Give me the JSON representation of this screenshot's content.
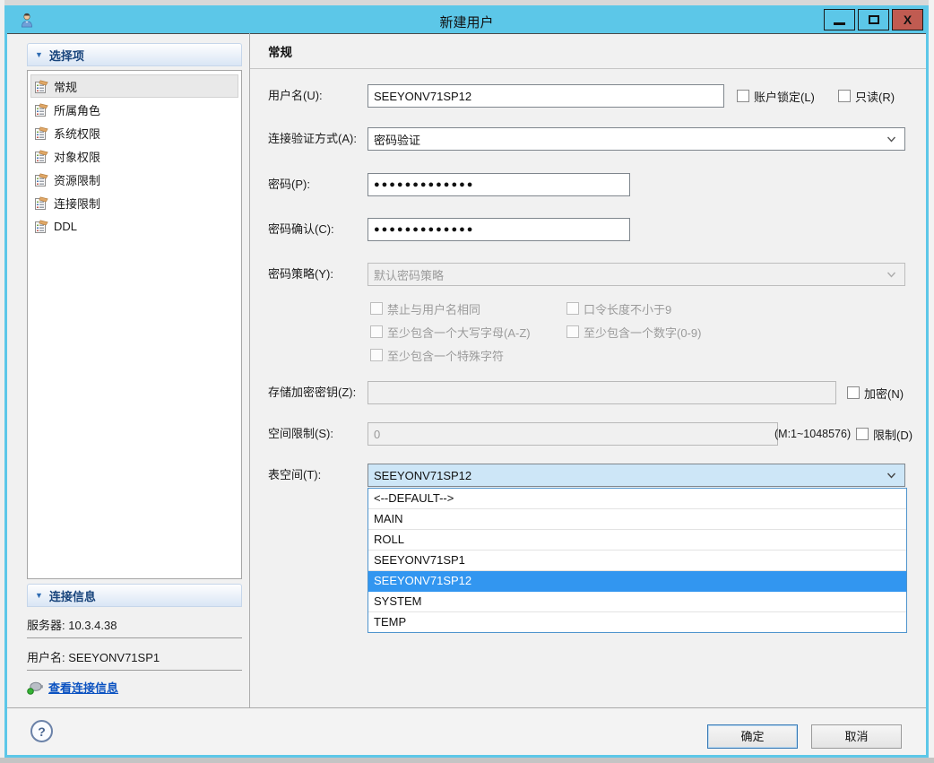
{
  "window": {
    "title": "新建用户",
    "close_glyph": "X"
  },
  "icons": {
    "collapse_arrow": "▼",
    "help": "?"
  },
  "sidebar": {
    "selection_header": "选择项",
    "items": [
      "常规",
      "所属角色",
      "系统权限",
      "对象权限",
      "资源限制",
      "连接限制",
      "DDL"
    ],
    "selected_item": "常规",
    "connection_header": "连接信息",
    "server": "服务器: 10.3.4.38",
    "username": "用户名: SEEYONV71SP1",
    "view_link": "查看连接信息"
  },
  "main": {
    "section_title": "常规",
    "username_label": "用户名(U):",
    "username_value": "SEEYONV71SP12",
    "account_lock_label": "账户锁定(L)",
    "readonly_label": "只读(R)",
    "auth_label": "连接验证方式(A):",
    "auth_value": "密码验证",
    "password_label": "密码(P):",
    "password_value": "●●●●●●●●●●●●●",
    "password_confirm_label": "密码确认(C):",
    "password_confirm_value": "●●●●●●●●●●●●●",
    "policy_label": "密码策略(Y):",
    "policy_value": "默认密码策略",
    "policy_checks": [
      "禁止与用户名相同",
      "口令长度不小于9",
      "至少包含一个大写字母(A-Z)",
      "至少包含一个数字(0-9)",
      "至少包含一个特殊字符"
    ],
    "enc_key_label": "存储加密密钥(Z):",
    "enc_key_value": "",
    "encrypt_label": "加密(N)",
    "space_label": "空间限制(S):",
    "space_value": "0",
    "space_hint": "(M:1~1048576)",
    "limit_label": "限制(D)",
    "tablespace_label": "表空间(T):",
    "tablespace_value": "SEEYONV71SP12",
    "dropdown_options": [
      "<--DEFAULT-->",
      "MAIN",
      "ROLL",
      "SEEYONV71SP1",
      "SEEYONV71SP12",
      "SYSTEM",
      "TEMP"
    ],
    "dropdown_selected": "SEEYONV71SP12"
  },
  "footer": {
    "ok": "确定",
    "cancel": "取消"
  },
  "colors": {
    "titlebar": "#5CC7E8",
    "close_button": "#C05B51",
    "list_highlight": "#3296F0",
    "combo_focus": "#CDE6F7",
    "link": "#0B52C1"
  }
}
